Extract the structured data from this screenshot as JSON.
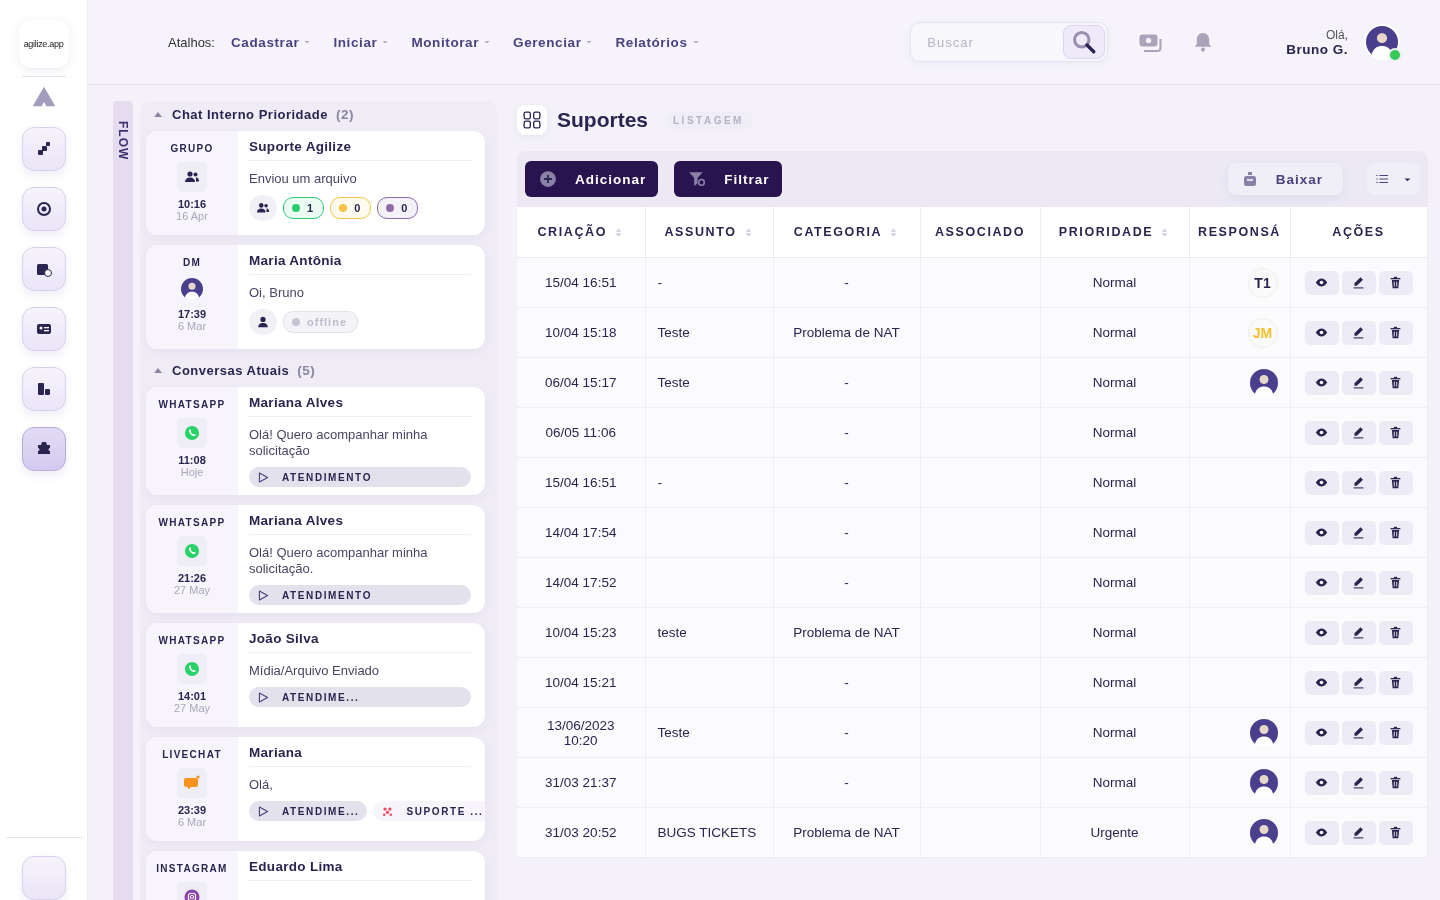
{
  "logo": {
    "text": "agilize.app"
  },
  "rail": {
    "items": [
      {
        "selected": false
      },
      {
        "selected": false
      },
      {
        "selected": false
      },
      {
        "selected": false
      },
      {
        "selected": false
      },
      {
        "selected": true
      }
    ]
  },
  "header": {
    "shortcuts_label": "Atalhos:",
    "menus": [
      "Cadastrar",
      "Iniciar",
      "Monitorar",
      "Gerenciar",
      "Relatórios"
    ],
    "search": {
      "placeholder": "Buscar"
    },
    "greeting": "Olá,",
    "user": "Bruno G.",
    "online": true
  },
  "flow": {
    "label": "FLOW"
  },
  "chat": {
    "sections": [
      {
        "title": "Chat Interno Prioridade",
        "count": "(2)",
        "expanded": true,
        "cards": [
          {
            "channel": "GRUPO",
            "kind": "group",
            "time": "10:16",
            "date": "16 Apr",
            "name": "Suporte Agilize",
            "message": "Enviou um arquivo",
            "footer": {
              "kind": "counts",
              "counts": [
                {
                  "value": "1",
                  "color": "#2ecc71"
                },
                {
                  "value": "0",
                  "color": "#f5c542"
                },
                {
                  "value": "0",
                  "color": "#8e6aa8"
                }
              ]
            }
          },
          {
            "channel": "DM",
            "kind": "dm",
            "time": "17:39",
            "date": "6 Mar",
            "name": "Maria Antônia",
            "message": "Oi, Bruno",
            "footer": {
              "kind": "status",
              "status": "offline"
            }
          }
        ]
      },
      {
        "title": "Conversas Atuais",
        "count": "(5)",
        "expanded": true,
        "cards": [
          {
            "channel": "WHATSAPP",
            "kind": "whatsapp",
            "time": "11:08",
            "date": "Hoje",
            "name": "Mariana Alves",
            "message": "Olá! Quero acompanhar minha solicitação",
            "footer": {
              "kind": "tags",
              "tags": [
                {
                  "kind": "queue",
                  "label": "ATENDIMENTO"
                }
              ]
            }
          },
          {
            "channel": "WHATSAPP",
            "kind": "whatsapp",
            "time": "21:26",
            "date": "27 May",
            "name": "Mariana Alves",
            "message": "Olá! Quero acompanhar minha solicitação.",
            "footer": {
              "kind": "tags",
              "tags": [
                {
                  "kind": "queue",
                  "label": "ATENDIMENTO"
                }
              ]
            }
          },
          {
            "channel": "WHATSAPP",
            "kind": "whatsapp",
            "time": "14:01",
            "date": "27 May",
            "name": "João Silva",
            "message": "Mídia/Arquivo Enviado",
            "footer": {
              "kind": "tags",
              "tags": [
                {
                  "kind": "queue",
                  "label": "ATENDIME..."
                }
              ]
            }
          },
          {
            "channel": "LIVECHAT",
            "kind": "livechat",
            "time": "23:39",
            "date": "6 Mar",
            "name": "Mariana",
            "message": "Olá,",
            "footer": {
              "kind": "tags",
              "tags": [
                {
                  "kind": "queue",
                  "label": "ATENDIME..."
                },
                {
                  "kind": "team",
                  "label": "SUPORTE ..."
                }
              ]
            }
          },
          {
            "channel": "INSTAGRAM",
            "kind": "instagram",
            "name": "Eduardo Lima"
          }
        ]
      }
    ]
  },
  "page": {
    "title": "Suportes",
    "badge": "LISTAGEM"
  },
  "toolbar": {
    "add": "Adicionar",
    "filter": "Filtrar",
    "download": "Baixar"
  },
  "table": {
    "columns": [
      {
        "label": "CRIAÇÃO",
        "sortable": true
      },
      {
        "label": "ASSUNTO",
        "sortable": true
      },
      {
        "label": "CATEGORIA",
        "sortable": true
      },
      {
        "label": "ASSOCIADO",
        "sortable": false
      },
      {
        "label": "PRIORIDADE",
        "sortable": true
      },
      {
        "label": "RESPONSÁ",
        "sortable": false
      },
      {
        "label": "AÇÕES",
        "sortable": false
      }
    ],
    "rows": [
      {
        "created": "15/04 16:51",
        "subject": "-",
        "category": "-",
        "priority": "Normal",
        "responsible": {
          "kind": "initials",
          "text": "T1",
          "color": "#2a2550"
        }
      },
      {
        "created": "10/04 15:18",
        "subject": "Teste",
        "category": "Problema de NAT",
        "priority": "Normal",
        "responsible": {
          "kind": "initials",
          "text": "JM",
          "color": "#f0c030"
        }
      },
      {
        "created": "06/04 15:17",
        "subject": "Teste",
        "category": "-",
        "priority": "Normal",
        "responsible": {
          "kind": "avatar"
        }
      },
      {
        "created": "06/05 11:06",
        "category": "-",
        "priority": "Normal"
      },
      {
        "created": "15/04 16:51",
        "subject": "-",
        "category": "-",
        "priority": "Normal"
      },
      {
        "created": "14/04 17:54",
        "category": "-",
        "priority": "Normal"
      },
      {
        "created": "14/04 17:52",
        "category": "-",
        "priority": "Normal"
      },
      {
        "created": "10/04 15:23",
        "subject": "teste",
        "category": "Problema de NAT",
        "priority": "Normal"
      },
      {
        "created": "10/04 15:21",
        "category": "-",
        "priority": "Normal"
      },
      {
        "created": "13/06/2023 10:20",
        "subject": "Teste",
        "category": "-",
        "priority": "Normal",
        "responsible": {
          "kind": "avatar"
        }
      },
      {
        "created": "31/03 21:37",
        "category": "-",
        "priority": "Normal",
        "responsible": {
          "kind": "avatar"
        }
      },
      {
        "created": "31/03 20:52",
        "subject": "BUGS TICKETS",
        "category": "Problema de NAT",
        "priority": "Urgente",
        "responsible": {
          "kind": "avatar"
        }
      }
    ]
  }
}
